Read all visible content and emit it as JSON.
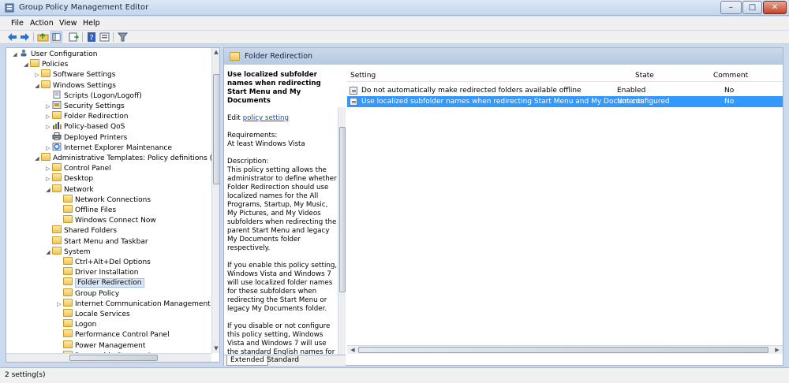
{
  "window": {
    "title": "Group Policy Management Editor",
    "minimize": "–",
    "maximize": "□",
    "close": "✕"
  },
  "menu": [
    "File",
    "Action",
    "View",
    "Help"
  ],
  "toolbar_icons": [
    "back-arrow-icon",
    "forward-arrow-icon",
    "up-folder-icon",
    "show-hide-tree-icon",
    "export-list-icon",
    "help-icon",
    "properties-icon",
    "filter-icon"
  ],
  "tree": [
    {
      "label": "User Configuration",
      "depth": 0,
      "exp": "◢",
      "icon": "user-config"
    },
    {
      "label": "Policies",
      "depth": 1,
      "exp": "◢",
      "icon": "folder"
    },
    {
      "label": "Software Settings",
      "depth": 2,
      "exp": "▷",
      "icon": "folder"
    },
    {
      "label": "Windows Settings",
      "depth": 2,
      "exp": "◢",
      "icon": "folder"
    },
    {
      "label": "Scripts (Logon/Logoff)",
      "depth": 3,
      "exp": "",
      "icon": "script"
    },
    {
      "label": "Security Settings",
      "depth": 3,
      "exp": "▷",
      "icon": "security"
    },
    {
      "label": "Folder Redirection",
      "depth": 3,
      "exp": "▷",
      "icon": "folder"
    },
    {
      "label": "Policy-based QoS",
      "depth": 3,
      "exp": "▷",
      "icon": "qos"
    },
    {
      "label": "Deployed Printers",
      "depth": 3,
      "exp": "",
      "icon": "printer"
    },
    {
      "label": "Internet Explorer Maintenance",
      "depth": 3,
      "exp": "▷",
      "icon": "ie"
    },
    {
      "label": "Administrative Templates: Policy definitions (ADMX",
      "depth": 2,
      "exp": "◢",
      "icon": "folder"
    },
    {
      "label": "Control Panel",
      "depth": 3,
      "exp": "▷",
      "icon": "folder"
    },
    {
      "label": "Desktop",
      "depth": 3,
      "exp": "▷",
      "icon": "folder"
    },
    {
      "label": "Network",
      "depth": 3,
      "exp": "◢",
      "icon": "folder"
    },
    {
      "label": "Network Connections",
      "depth": 4,
      "exp": "",
      "icon": "folder"
    },
    {
      "label": "Offline Files",
      "depth": 4,
      "exp": "",
      "icon": "folder"
    },
    {
      "label": "Windows Connect Now",
      "depth": 4,
      "exp": "",
      "icon": "folder"
    },
    {
      "label": "Shared Folders",
      "depth": 3,
      "exp": "",
      "icon": "folder"
    },
    {
      "label": "Start Menu and Taskbar",
      "depth": 3,
      "exp": "",
      "icon": "folder"
    },
    {
      "label": "System",
      "depth": 3,
      "exp": "◢",
      "icon": "folder"
    },
    {
      "label": "Ctrl+Alt+Del Options",
      "depth": 4,
      "exp": "",
      "icon": "folder"
    },
    {
      "label": "Driver Installation",
      "depth": 4,
      "exp": "",
      "icon": "folder"
    },
    {
      "label": "Folder Redirection",
      "depth": 4,
      "exp": "",
      "icon": "folder",
      "selected": true
    },
    {
      "label": "Group Policy",
      "depth": 4,
      "exp": "",
      "icon": "folder"
    },
    {
      "label": "Internet Communication Management",
      "depth": 4,
      "exp": "▷",
      "icon": "folder"
    },
    {
      "label": "Locale Services",
      "depth": 4,
      "exp": "",
      "icon": "folder"
    },
    {
      "label": "Logon",
      "depth": 4,
      "exp": "",
      "icon": "folder"
    },
    {
      "label": "Performance Control Panel",
      "depth": 4,
      "exp": "",
      "icon": "folder"
    },
    {
      "label": "Power Management",
      "depth": 4,
      "exp": "",
      "icon": "folder"
    },
    {
      "label": "Removable Storage Access",
      "depth": 4,
      "exp": "",
      "icon": "folder"
    }
  ],
  "right_header": {
    "title": "Folder Redirection"
  },
  "description": {
    "title": "Use localized subfolder names when redirecting Start Menu and My Documents",
    "edit_prefix": "Edit",
    "edit_link": "policy setting",
    "requirements_label": "Requirements:",
    "requirements": "At least Windows Vista",
    "description_label": "Description:",
    "p1": "This policy setting allows the administrator to define whether Folder Redirection should use localized names for the All Programs, Startup, My Music, My Pictures, and My Videos subfolders when redirecting the parent Start Menu and legacy My Documents folder respectively.",
    "p2": "If you enable this policy setting, Windows Vista and Windows 7 will use localized folder names for these subfolders when redirecting the Start Menu or legacy My Documents folder.",
    "p3": "If you disable or not configure this policy setting, Windows Vista and Windows 7 will use the standard English names for these subfolders when redirecting the Start Menu or legacy My"
  },
  "tabs": {
    "extended": "Extended",
    "standard": "Standard"
  },
  "list": {
    "columns": {
      "setting": "Setting",
      "state": "State",
      "comment": "Comment"
    },
    "rows": [
      {
        "setting": "Do not automatically make redirected folders available offline",
        "state": "Enabled",
        "comment": "No"
      },
      {
        "setting": "Use localized subfolder names when redirecting Start Menu and My Documents",
        "state": "Not configured",
        "comment": "No",
        "selected": true
      }
    ]
  },
  "status": {
    "text": "2 setting(s)"
  },
  "colors": {
    "selection": "#3399ff",
    "header": "#b6c9e1",
    "link": "#1a4fb4"
  }
}
